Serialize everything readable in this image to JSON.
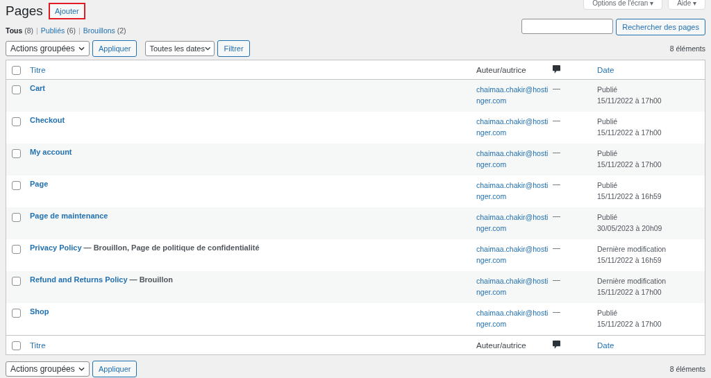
{
  "top_buttons": [
    {
      "label": "Options de l'écran",
      "caret": "▾"
    },
    {
      "label": "Aide",
      "caret": "▾"
    }
  ],
  "title": "Pages",
  "add_button": "Ajouter",
  "filters": [
    {
      "label": "Tous",
      "count": "(8)",
      "selected": true,
      "separator": "|"
    },
    {
      "label": "Publiés",
      "count": "(6)",
      "selected": false,
      "separator": "|"
    },
    {
      "label": "Brouillons",
      "count": "(2)",
      "selected": false
    }
  ],
  "search": {
    "button": "Rechercher des pages"
  },
  "bulk_actions": {
    "value": "Actions groupées",
    "apply": "Appliquer"
  },
  "date_filter": {
    "value": "Toutes les dates",
    "button": "Filtrer"
  },
  "item_count": "8 éléments",
  "columns": {
    "title": "Titre",
    "author": "Auteur/autrice",
    "date": "Date",
    "checked": false
  },
  "footer_columns": {
    "title": "Titre",
    "author": "Auteur/autrice",
    "date": "Date",
    "checked": false
  },
  "rows": [
    {
      "title": "Cart",
      "state": "",
      "author": "chaimaa.chakir@hostinger.com",
      "comments": "—",
      "status": "Publié",
      "date": "15/11/2022 à 17h00",
      "checked": false
    },
    {
      "title": "Checkout",
      "state": "",
      "author": "chaimaa.chakir@hostinger.com",
      "comments": "—",
      "status": "Publié",
      "date": "15/11/2022 à 17h00",
      "checked": false
    },
    {
      "title": "My account",
      "state": "",
      "author": "chaimaa.chakir@hostinger.com",
      "comments": "—",
      "status": "Publié",
      "date": "15/11/2022 à 17h00",
      "checked": false
    },
    {
      "title": "Page",
      "state": "",
      "author": "chaimaa.chakir@hostinger.com",
      "comments": "—",
      "status": "Publié",
      "date": "15/11/2022 à 16h59",
      "checked": false
    },
    {
      "title": "Page de maintenance",
      "state": "",
      "author": "chaimaa.chakir@hostinger.com",
      "comments": "—",
      "status": "Publié",
      "date": "30/05/2023 à 20h09",
      "checked": false
    },
    {
      "title": "Privacy Policy",
      "state": "— Brouillon, Page de politique de confidentialité",
      "author": "chaimaa.chakir@hostinger.com",
      "comments": "—",
      "status": "Dernière modification",
      "date": "15/11/2022 à 16h59",
      "checked": false
    },
    {
      "title": "Refund and Returns Policy",
      "state": "— Brouillon",
      "author": "chaimaa.chakir@hostinger.com",
      "comments": "—",
      "status": "Dernière modification",
      "date": "15/11/2022 à 17h00",
      "checked": false
    },
    {
      "title": "Shop",
      "state": "",
      "author": "chaimaa.chakir@hostinger.com",
      "comments": "—",
      "status": "Publié",
      "date": "15/11/2022 à 17h00",
      "checked": false
    }
  ],
  "bottom_bulk_actions": {
    "value": "Actions groupées",
    "apply": "Appliquer"
  },
  "bottom_item_count": "8 éléments"
}
